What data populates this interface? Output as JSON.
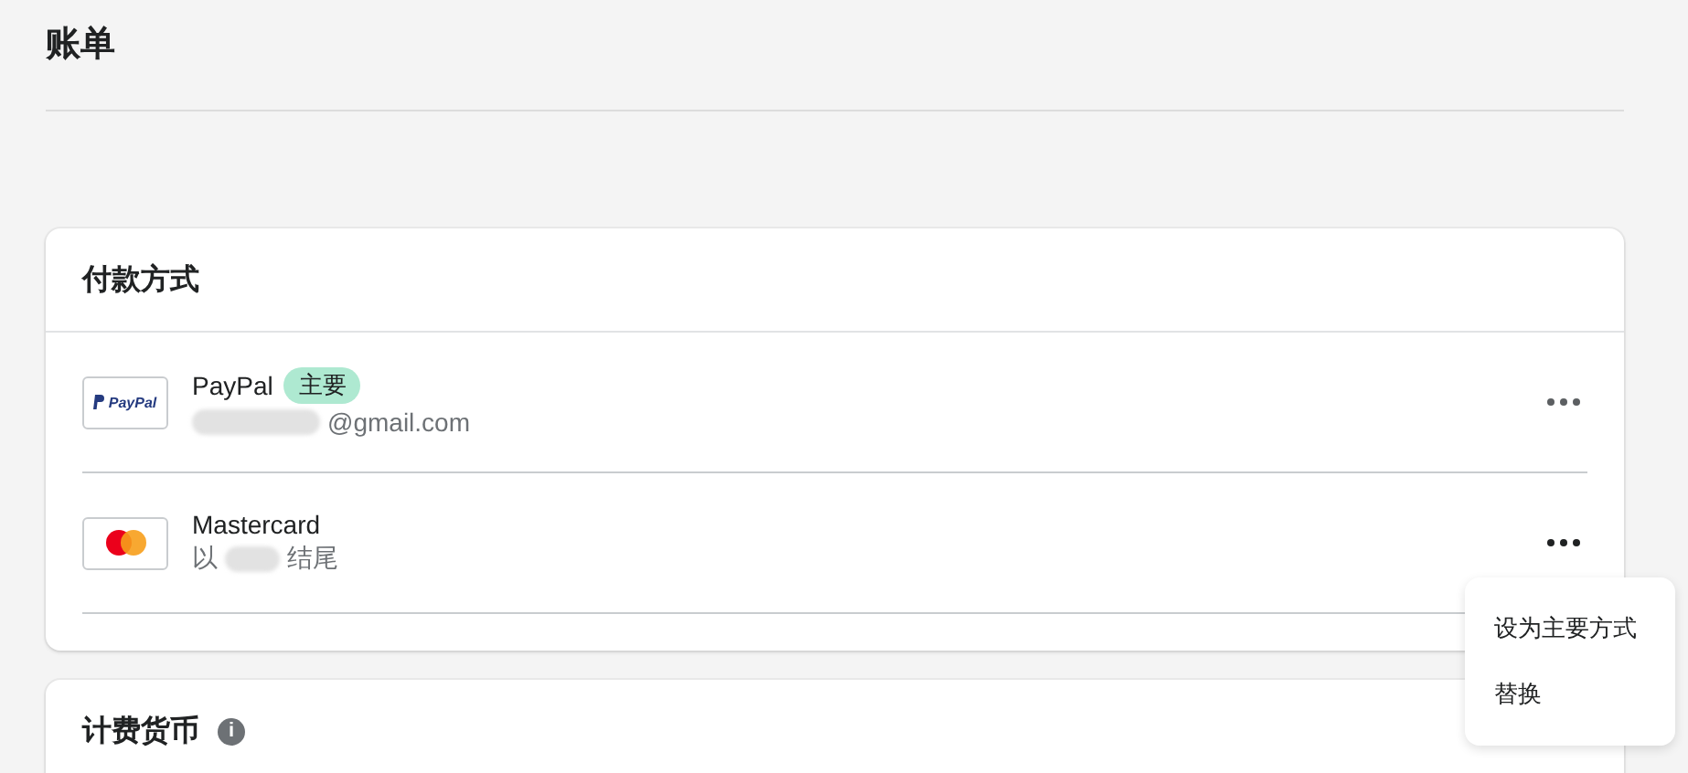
{
  "page": {
    "title": "账单"
  },
  "payment_methods": {
    "title": "付款方式",
    "items": [
      {
        "kind": "paypal",
        "logo_text": "PayPal",
        "name": "PayPal",
        "badge": "主要",
        "detail_after": "@gmail.com",
        "redacted": true
      },
      {
        "kind": "mastercard",
        "name": "Mastercard",
        "detail_before": "以",
        "detail_after": "结尾",
        "redacted": true
      }
    ]
  },
  "menu": {
    "items": [
      "设为主要方式",
      "替换"
    ]
  },
  "billing_currency": {
    "title": "计费货币",
    "info_icon": "i"
  }
}
